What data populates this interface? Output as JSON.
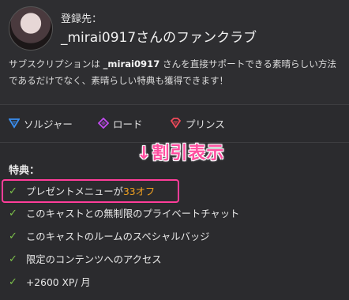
{
  "header": {
    "reg_label": "登録先：",
    "club_title": "_mirai0917さんのファンクラブ",
    "description_pre": "サブスクリプションは ",
    "description_name": "_mirai0917",
    "description_post": " さんを直接サポートできる素晴らしい方法であるだけでなく、素晴らしい特典も獲得できます！"
  },
  "tiers": [
    {
      "label": "ソルジャー",
      "icon": "blue-triangle-icon",
      "color": "#3a8ef0"
    },
    {
      "label": "ロード",
      "icon": "purple-diamond-icon",
      "color": "#c24bf0"
    },
    {
      "label": "プリンス",
      "icon": "red-gem-icon",
      "color": "#f04a5a"
    }
  ],
  "callout": "↓割引表示",
  "benefits": {
    "title": "特典：",
    "items": [
      {
        "text": "プレゼントメニューが",
        "extra": "33オフ"
      },
      {
        "text": "このキャストとの無制限のプライベートチャット"
      },
      {
        "text": "このキャストのルームのスペシャルバッジ"
      },
      {
        "text": "限定のコンテンツへのアクセス"
      },
      {
        "text": "+2600 XP/ 月"
      }
    ]
  }
}
